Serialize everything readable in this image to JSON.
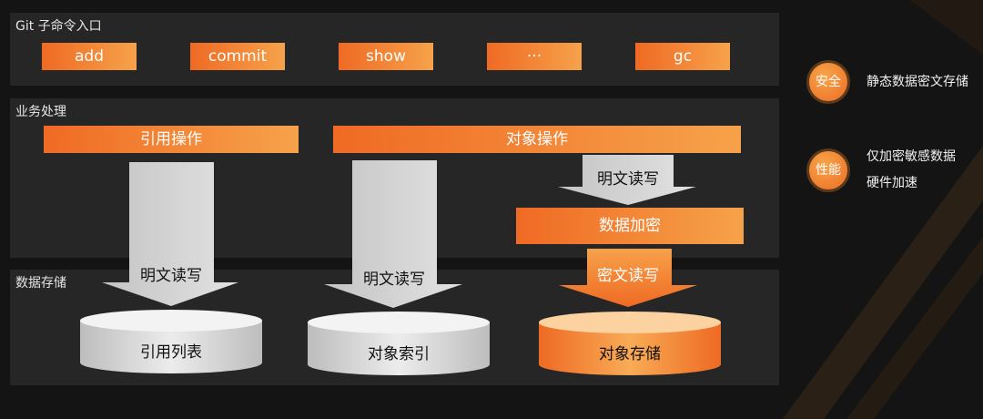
{
  "sections": {
    "git_entry": "Git 子命令入口",
    "business": "业务处理",
    "storage": "数据存储"
  },
  "commands": [
    "add",
    "commit",
    "show",
    "···",
    "gc"
  ],
  "bars": {
    "ref_op": "引用操作",
    "obj_op": "对象操作",
    "encrypt": "数据加密"
  },
  "arrows": {
    "plain_rw_ref": "明文读写",
    "plain_rw_index": "明文读写",
    "plain_rw_obj": "明文读写",
    "cipher_rw": "密文读写"
  },
  "storages": {
    "ref_list": "引用列表",
    "obj_index": "对象索引",
    "obj_store": "对象存储"
  },
  "side": {
    "security_badge": "安全",
    "security_text": "静态数据密文存储",
    "perf_badge": "性能",
    "perf_line1": "仅加密敏感数据",
    "perf_line2": "硬件加速"
  },
  "colors": {
    "accent": "#ef6a24",
    "accent_light": "#f6a24a",
    "panel": "#262626"
  }
}
